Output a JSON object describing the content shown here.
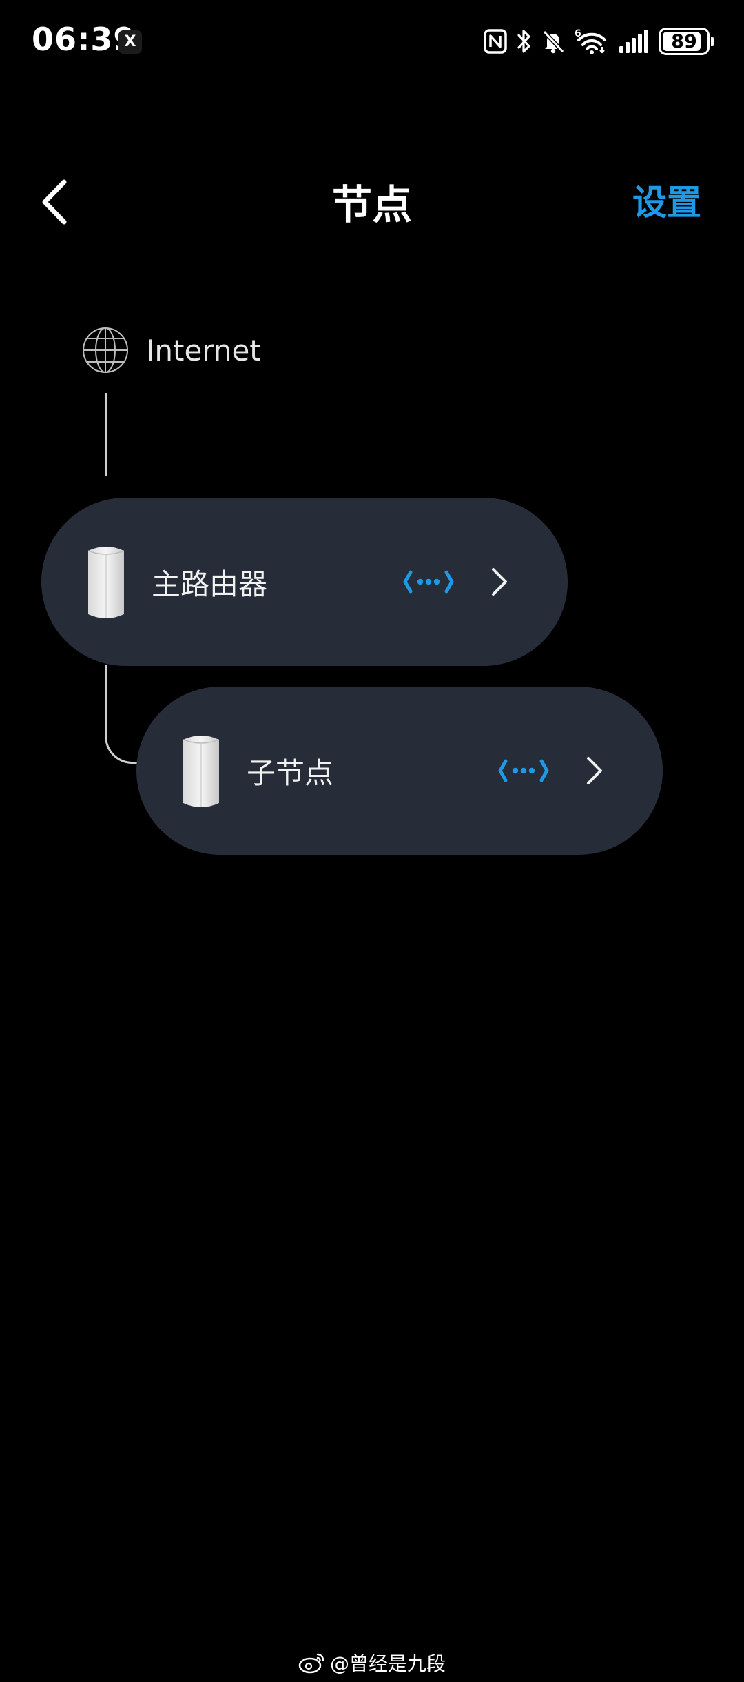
{
  "status_bar": {
    "time": "06:39",
    "notification_app_glyph": "X",
    "battery_level": 89,
    "battery_text": "89",
    "icons": [
      "nfc-icon",
      "bluetooth-icon",
      "bell-muted-icon",
      "wifi-6-icon",
      "cellular-signal-icon",
      "battery-icon"
    ]
  },
  "header": {
    "title": "节点",
    "settings_label": "设置"
  },
  "topology": {
    "internet_label": "Internet",
    "nodes": [
      {
        "name": "主路由器"
      },
      {
        "name": "子节点"
      }
    ]
  },
  "watermark": {
    "text": "@曾经是九段"
  },
  "colors": {
    "accent": "#1f98e6",
    "card_background": "#262d38",
    "background": "#000000"
  }
}
